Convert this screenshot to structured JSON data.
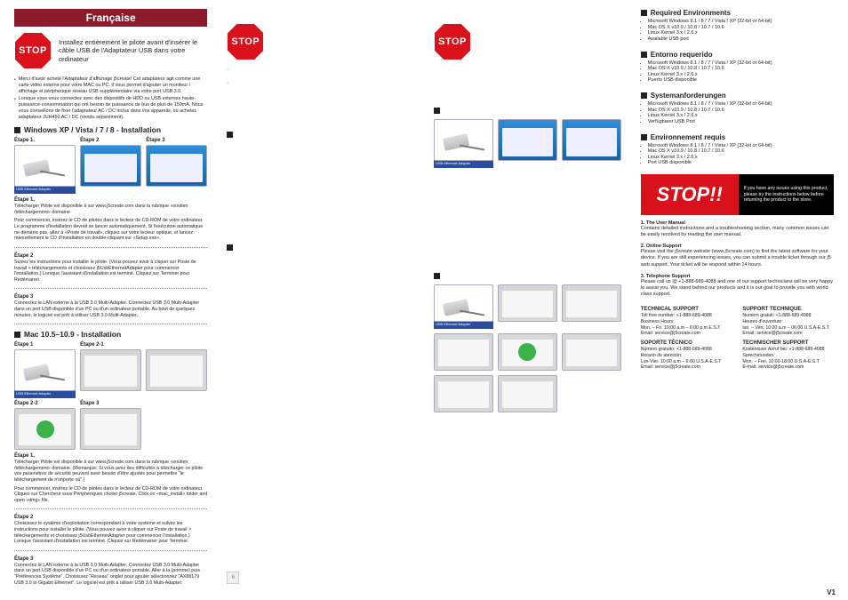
{
  "col1": {
    "ribbon": "Française",
    "stop_label": "STOP",
    "stop_msg": "Installez entièrement le pilote avant d'insérer le câble USB de l'Adaptateur USB dans votre ordinateur",
    "bullets": [
      "Merci d'avoir acheté l'Adaptateur d'affichage j5create! Cet adaptateur agit comme une carte vidéo externe pour votre MAC ou PC. Il vous permet d'ajouter un moniteur / affichage et périphérique réseau USB supplémentaire via votre port USB 3.0.",
      "Lorsque vous vous connectez avec des dispositifs de HDD ou USB externes haute-puissance-consommation qui ont besoin de puissance de bus de plus de 150mA. Nous vous conseillons de fixer l'adaptateur AC / DC inclus dans vos appareils, ou achetez adaptateur JUH450 AC / DC (vendu séparément)."
    ],
    "win_title": "Windows XP / Vista / 7 / 8 - Installation",
    "win_steps": [
      "Étape 1.",
      "Étape 2",
      "Étape 3"
    ],
    "adapter_caption": "USB Ethernet Adapter",
    "win_s1_label": "Étape 1.",
    "win_s1_text": "Télécharger Pilote est disponible à sur www.j5create.com dans la rubrique «soutien /téléchargement» domaine",
    "win_s1b_text": "Pour commencer, insérez le CD de pilotes dans le lecteur de CD-ROM de votre ordinateur. Le programme d'installation devrait se lancer automatiquement. Si l'exécution automatique ne démarre pas, allez à «Poste de travail», cliquez sur votre lecteur optique, et lancez manuellement le CD d'installation en double-cliquant sur «Setup.exe».",
    "win_s2_label": "Étape 2",
    "win_s2_text": "Suivez les instructions pour installer le pilote. (Vous pouvez avoir à cliquer sur Poste de travail > téléchargements et choisissez j5UsbEthernetAdapter pour commencer l'installation.) Lorsque l'assistant d'installation est terminé. Cliquez sur Terminer pour Redémarrer.",
    "win_s3_label": "Étape 3",
    "win_s3_text": "Connectez le LAN externe à la USB 3.0 Multi-Adapter. Connectez USB 3.0 Multi-Adapter dans un port USB disponible d'un PC ou d'un ordinateur portable. Au bout de quelques minutes, le logiciel est prêt à utiliser USB 3.0 Multi-Adapter.",
    "mac_title": "Mac 10.5–10.9 - Installation",
    "mac_steps_top": [
      "Étape 1",
      "Étape 2-1"
    ],
    "mac_steps_bottom": [
      "Étape 2-2",
      "Étape 3"
    ],
    "mac_s1_label": "Étape 1.",
    "mac_s1_text": "Télécharger Pilote est disponible à sur www.j5create.com dans la rubrique «soutien /téléchargement» domaine. (Remarque: Si vous avez des difficultés à télécharger ce pilote vos paramètres de sécurité peuvent avoir besoin d'être ajustés pour permettre \"le téléchargement de n'importe où\".)",
    "mac_s1b_text": "Pour commencer, insérez le CD de pilotes dans le lecteur de CD-ROM de votre ordinateur. Cliquez sur Chercheur sous Périphériques choisir j5create. Click on «mac_install» folder and open «dmg» file.",
    "mac_s2_label": "Étape 2",
    "mac_s2_text": "Choisissez le système d'exploitation correspondant à votre système et suivez les instructions pour installer le pilote. (Vous pouvez avoir à cliquer sur Poste de travail > téléchargements et choisissez j5UsbEthernetAdapter pour commencer l'installation.) Lorsque l'assistant d'installation est terminé. Cliquez sur Redémarrer pour Terminer.",
    "mac_s3_label": "Étape 3",
    "mac_s3_text": "Connectez le LAN externe à la USB 3.0 Multi-Adapter. Connectez USB 3.0 Multi-Adapter dans un port USB disponible d'un PC ou d'un ordinateur portable. Aller à la (pomme) puis \"Préférences Système\". Choisissez \"Réseau\" onglet pour ajouter sélectionnez \"AX88179 USB 3.0 to Gigabit Ethernet\". Le logiciel est prêt à utiliser USB 3.0 Multi-Adapter."
  },
  "col2": {
    "stop_label": "STOP",
    "page_num": "6"
  },
  "col3": {
    "stop_label": "STOP",
    "adapter_caption": "USB Ethernet Adapter"
  },
  "col4": {
    "env": [
      {
        "title": "Required Environments",
        "items": [
          "Microsoft Windows 8.1 / 8 / 7 / Vista / XP (32-bit or 64-bit)",
          "Mac OS X v10.9 / 10.8 / 10.7 / 10.6",
          "Linux Kernel 3.x / 2.6.x",
          "Available USB port"
        ]
      },
      {
        "title": "Entorno requerido",
        "items": [
          "Microsoft Windows 8.1 / 8 / 7 / Vista / XP (32-bit or 64-bit)",
          "Mac OS X v10.9 / 10.8 / 10.7 / 10.6",
          "Linux Kernel 3.x / 2.6.x",
          "Puerto USB disponible"
        ]
      },
      {
        "title": "Systemanforderungen",
        "items": [
          "Microsoft Windows 8.1 / 8 / 7 / Vista / XP (32-bit or 64-bit)",
          "Mac OS X v10.9 / 10.8 / 10.7 / 10.6",
          "Linux Kernel 3.x / 2.6.x",
          "Verfügbarer USB Port"
        ]
      },
      {
        "title": "Environnement requis",
        "items": [
          "Microsoft Windows 8.1 / 8 / 7 / Vista / XP (32-bit or 64-bit)",
          "Mac OS X v10.9 / 10.8 / 10.7 / 10.6",
          "Linux Kernel 3.x / 2.6.x",
          "Port USB disponible"
        ]
      }
    ],
    "banner_big": "STOP!!",
    "banner_txt": "If you have any issues using this product, please try the instructions below before returning the product to the store.",
    "help": [
      {
        "t": "1. The User Manual",
        "d": "Contains detailed instructions and a troubleshooting section, many common issues can be easily resolved by reading the user manual."
      },
      {
        "t": "2. Online Support",
        "d": "Please visit the j5create website (www.j5create.com) to find the latest software for your device. If you are still experiencing issues, you can submit a trouble ticket through our j5 web support. Your ticket will be respond within 24 hours."
      },
      {
        "t": "3. Telephone Support",
        "d": "Please call us @ +1-888-689-4088 and one of our support technicians will be very happy to assist you. We stand behind our products and it is our goal to provide you with world class support."
      }
    ],
    "support": [
      {
        "h": "TECHNICAL SUPPORT",
        "lines": [
          "Toll free number: +1-888-689-4088",
          "Business Hours:",
          "Mon. – Fri. 10:00 a.m – 6:00 p.m E.S.T",
          "Email: service@j5create.com"
        ]
      },
      {
        "h": "SUPPORT TECHNIQUE",
        "lines": [
          "Numéro gratuit: +1-888-689-4088",
          "Heures d'ouverture:",
          "lun. – Ven. 10:00 a.m – 06:00 U.S.A-E.S.T",
          "Email: service@j5create.com"
        ]
      },
      {
        "h": "SOPORTE TÉCNICO",
        "lines": [
          "Número gratuito: +1-888-689-4088",
          "Horario de atención:",
          "Lun-Vier. 10:00 a.m – 6:00 U.S.A-E.S.T",
          "Email: service@j5create.com"
        ]
      },
      {
        "h": "TECHNISCHER SUPPORT",
        "lines": [
          "Kostenloser Anruf bei: +1-888-689-4088",
          "Sprechstunden:",
          "Mon. – Frei. 10:00-18:00 U.S.A-E.S.T",
          "E-mail: service@j5create.com"
        ]
      }
    ]
  },
  "version": "V1"
}
